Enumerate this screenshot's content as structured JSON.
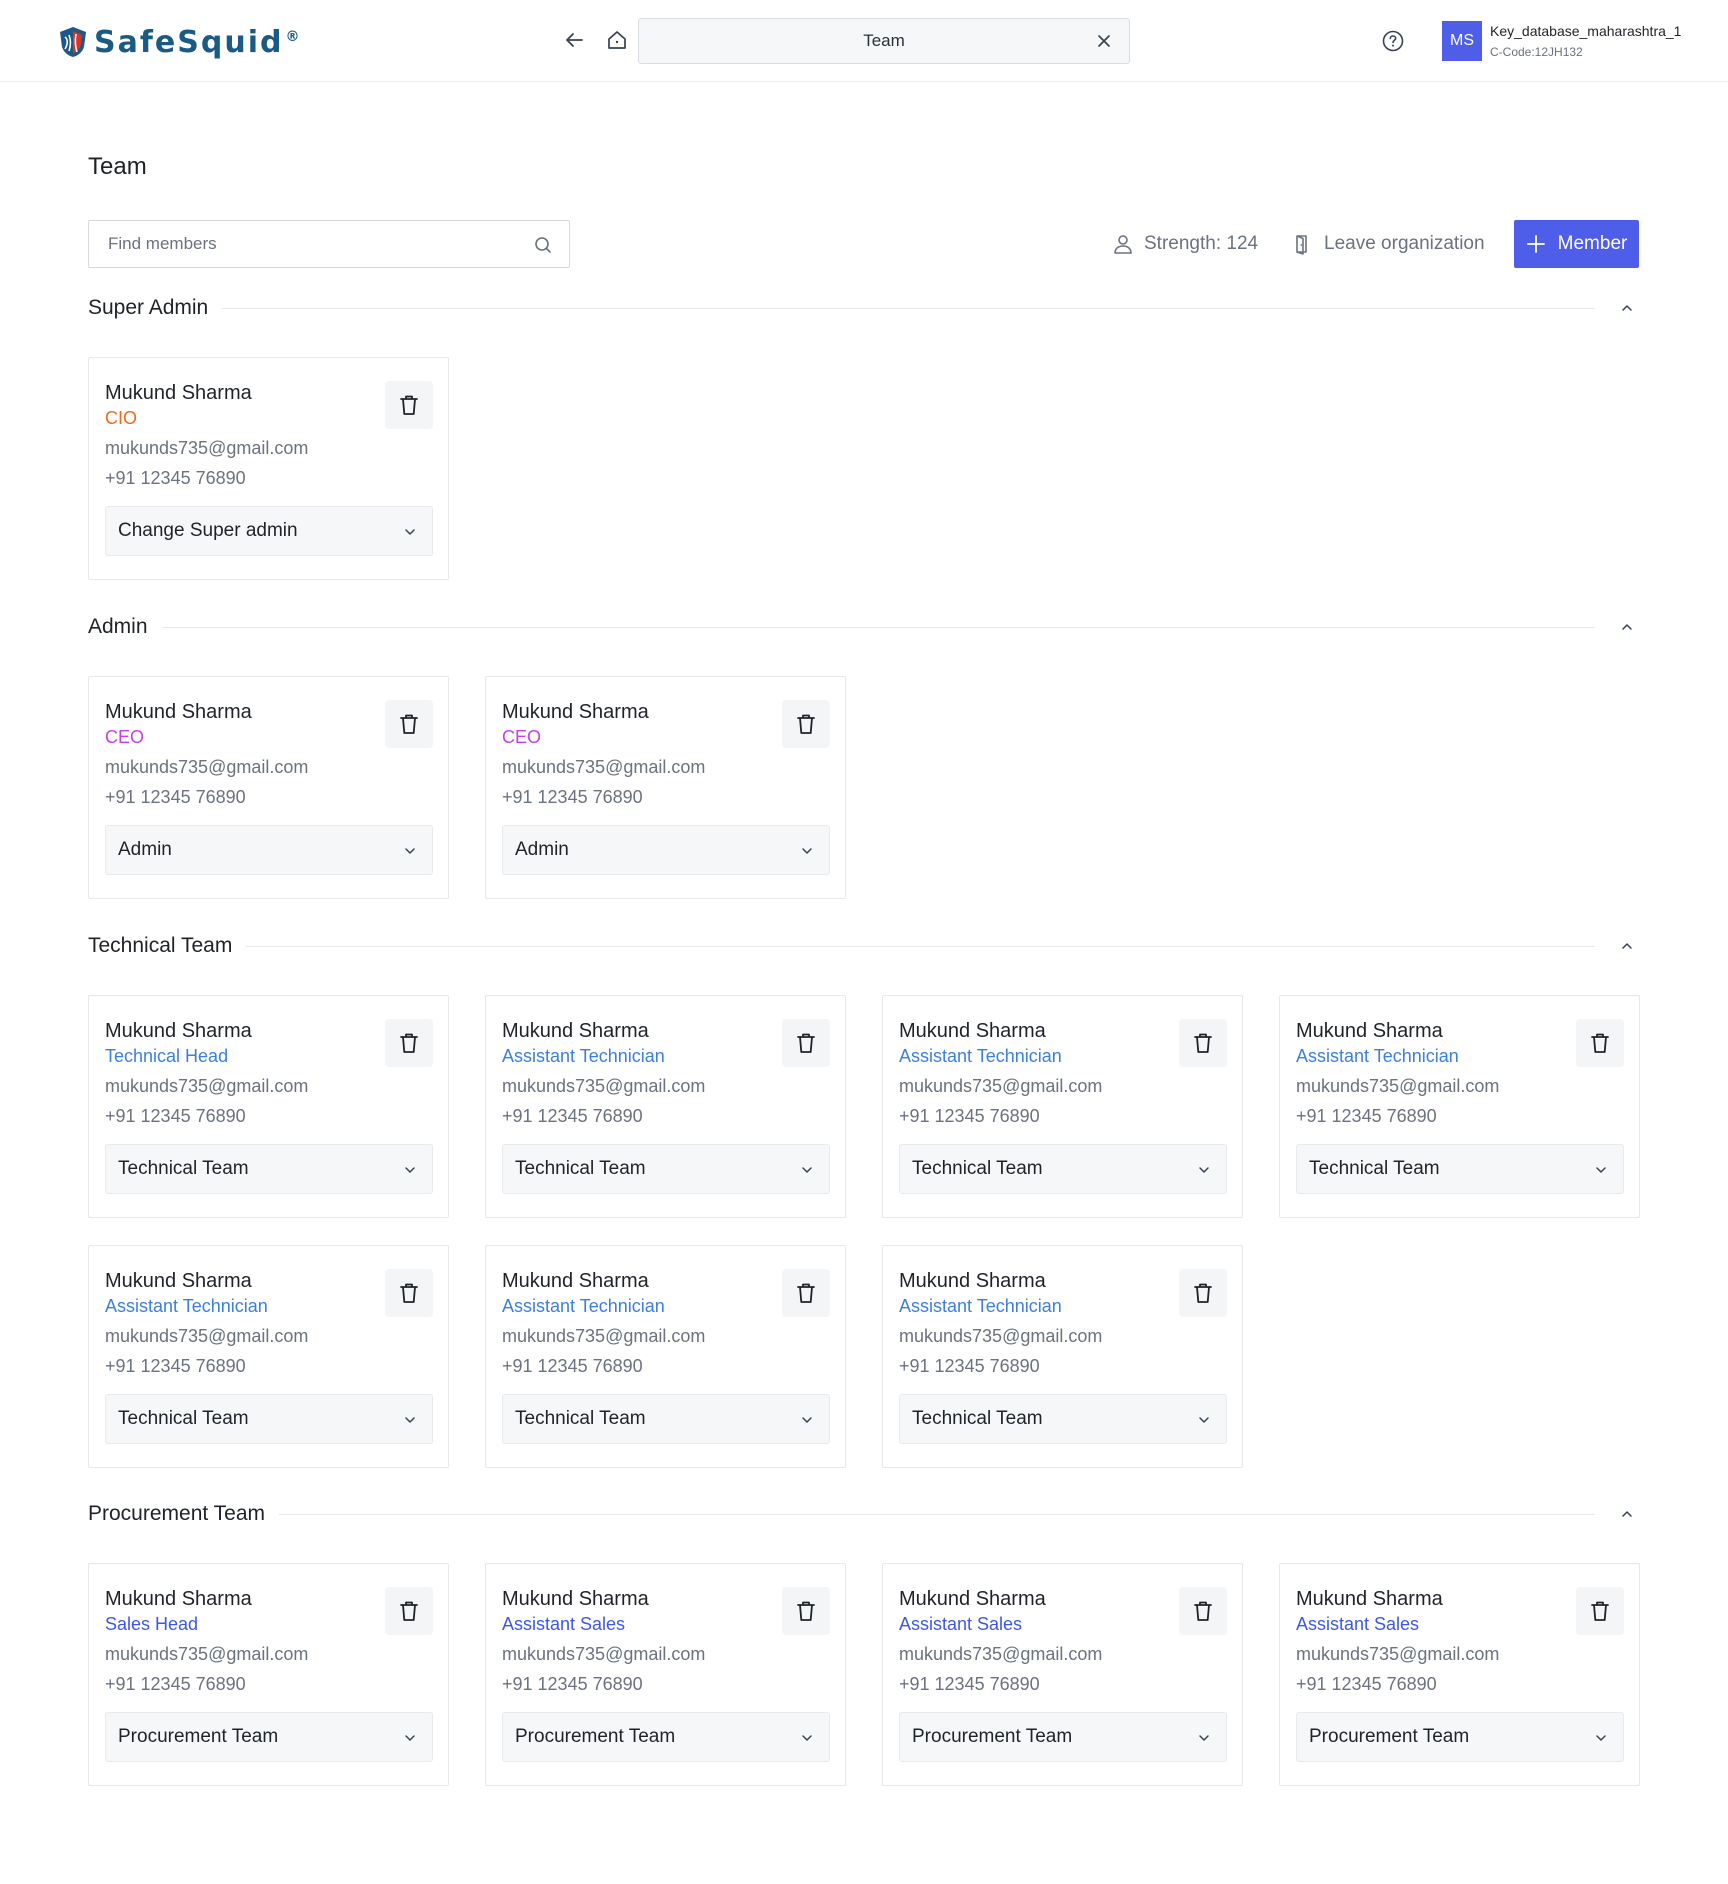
{
  "header": {
    "brand": "SafeSquid",
    "brand_mark": "®",
    "tab_title": "Team",
    "avatar_initials": "MS",
    "account_name": "Key_database_maharashtra_1",
    "account_code": "C-Code:12JH132"
  },
  "page": {
    "title": "Team",
    "search_placeholder": "Find members",
    "strength": "Strength: 124",
    "leave_label": "Leave organization",
    "member_button": "Member"
  },
  "colors": {
    "accent": "#4f5ee8",
    "role_cio": "#f06a1c",
    "role_ceo": "#c93ee6",
    "role_technical": "#3b7fe0",
    "role_sales": "#3f57e6"
  },
  "sections": [
    {
      "title": "Super Admin",
      "members": [
        {
          "name": "Mukund Sharma",
          "role": "CIO",
          "role_color": "#f06a1c",
          "email": "mukunds735@gmail.com",
          "phone": "+91 12345 76890",
          "group": "Change Super admin"
        }
      ]
    },
    {
      "title": "Admin",
      "members": [
        {
          "name": "Mukund Sharma",
          "role": "CEO",
          "role_color": "#c93ee6",
          "email": "mukunds735@gmail.com",
          "phone": "+91 12345 76890",
          "group": "Admin"
        },
        {
          "name": "Mukund Sharma",
          "role": "CEO",
          "role_color": "#c93ee6",
          "email": "mukunds735@gmail.com",
          "phone": "+91 12345 76890",
          "group": "Admin"
        }
      ]
    },
    {
      "title": "Technical Team",
      "members": [
        {
          "name": "Mukund Sharma",
          "role": "Technical Head",
          "role_color": "#3b7fe0",
          "email": "mukunds735@gmail.com",
          "phone": "+91 12345 76890",
          "group": "Technical Team"
        },
        {
          "name": "Mukund Sharma",
          "role": "Assistant Technician",
          "role_color": "#3b7fe0",
          "email": "mukunds735@gmail.com",
          "phone": "+91 12345 76890",
          "group": "Technical Team"
        },
        {
          "name": "Mukund Sharma",
          "role": "Assistant Technician",
          "role_color": "#3b7fe0",
          "email": "mukunds735@gmail.com",
          "phone": "+91 12345 76890",
          "group": "Technical Team"
        },
        {
          "name": "Mukund Sharma",
          "role": "Assistant Technician",
          "role_color": "#3b7fe0",
          "email": "mukunds735@gmail.com",
          "phone": "+91 12345 76890",
          "group": "Technical Team"
        },
        {
          "name": "Mukund Sharma",
          "role": "Assistant Technician",
          "role_color": "#3b7fe0",
          "email": "mukunds735@gmail.com",
          "phone": "+91 12345 76890",
          "group": "Technical Team"
        },
        {
          "name": "Mukund Sharma",
          "role": "Assistant Technician",
          "role_color": "#3b7fe0",
          "email": "mukunds735@gmail.com",
          "phone": "+91 12345 76890",
          "group": "Technical Team"
        },
        {
          "name": "Mukund Sharma",
          "role": "Assistant Technician",
          "role_color": "#3b7fe0",
          "email": "mukunds735@gmail.com",
          "phone": "+91 12345 76890",
          "group": "Technical Team"
        }
      ]
    },
    {
      "title": "Procurement Team",
      "members": [
        {
          "name": "Mukund Sharma",
          "role": "Sales Head",
          "role_color": "#3f57e6",
          "email": "mukunds735@gmail.com",
          "phone": "+91 12345 76890",
          "group": "Procurement Team"
        },
        {
          "name": "Mukund Sharma",
          "role": "Assistant Sales",
          "role_color": "#3f57e6",
          "email": "mukunds735@gmail.com",
          "phone": "+91 12345 76890",
          "group": "Procurement Team"
        },
        {
          "name": "Mukund Sharma",
          "role": "Assistant Sales",
          "role_color": "#3f57e6",
          "email": "mukunds735@gmail.com",
          "phone": "+91 12345 76890",
          "group": "Procurement Team"
        },
        {
          "name": "Mukund Sharma",
          "role": "Assistant Sales",
          "role_color": "#3f57e6",
          "email": "mukunds735@gmail.com",
          "phone": "+91 12345 76890",
          "group": "Procurement Team"
        }
      ]
    }
  ]
}
